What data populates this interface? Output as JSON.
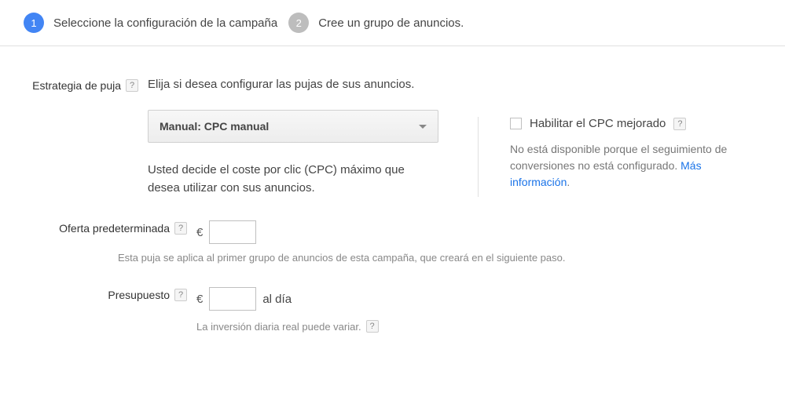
{
  "stepper": {
    "step1_num": "1",
    "step1_label": "Seleccione la configuración de la campaña",
    "step2_num": "2",
    "step2_label": "Cree un grupo de anuncios."
  },
  "bidding": {
    "label": "Estrategia de puja",
    "prompt": "Elija si desea configurar las pujas de sus anuncios.",
    "dropdown_value": "Manual: CPC manual",
    "description": "Usted decide el coste por clic (CPC) máximo que desea utilizar con sus anuncios.",
    "enhanced_label": "Habilitar el CPC mejorado",
    "enhanced_disabled": "No está disponible porque el seguimiento de conversiones no está configurado.",
    "more_info": "Más información"
  },
  "default_bid": {
    "label": "Oferta predeterminada",
    "currency": "€",
    "value": "",
    "helper": "Esta puja se aplica al primer grupo de anuncios de esta campaña, que creará en el siguiente paso."
  },
  "budget": {
    "label": "Presupuesto",
    "currency": "€",
    "value": "",
    "per_day": "al día",
    "helper": "La inversión diaria real puede variar."
  },
  "icons": {
    "help": "?"
  }
}
